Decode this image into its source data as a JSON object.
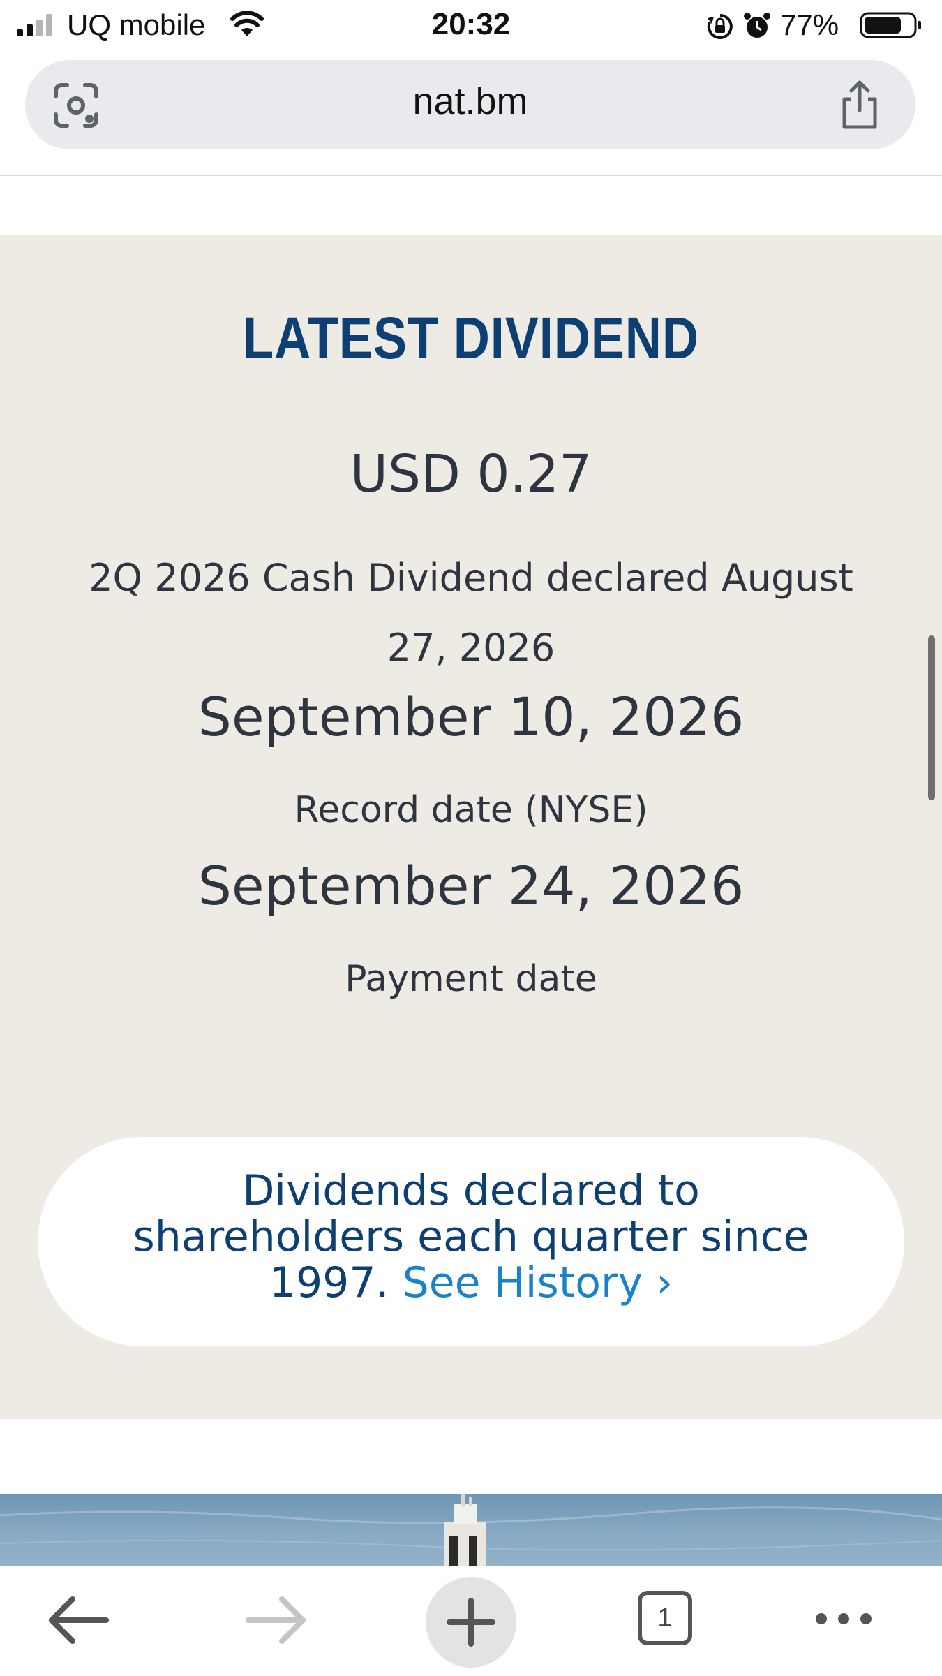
{
  "status_bar": {
    "carrier": "UQ mobile",
    "time": "20:32",
    "battery_percent": "77%",
    "battery_level": 0.77
  },
  "browser": {
    "url": "nat.bm",
    "tab_count": "1"
  },
  "dividend": {
    "title": "LATEST DIVIDEND",
    "amount": "USD 0.27",
    "declaration": "2Q 2026 Cash Dividend declared August 27, 2026",
    "record_date": "September 10, 2026",
    "record_date_label": "Record date (NYSE)",
    "payment_date": "September 24, 2026",
    "payment_date_label": "Payment date",
    "history_text": "Dividends declared to shareholders each quarter since 1997.",
    "history_link": "See History ›"
  },
  "colors": {
    "accent": "#0d3f73",
    "link": "#1a82c9",
    "section_bg": "#eeebe5"
  }
}
